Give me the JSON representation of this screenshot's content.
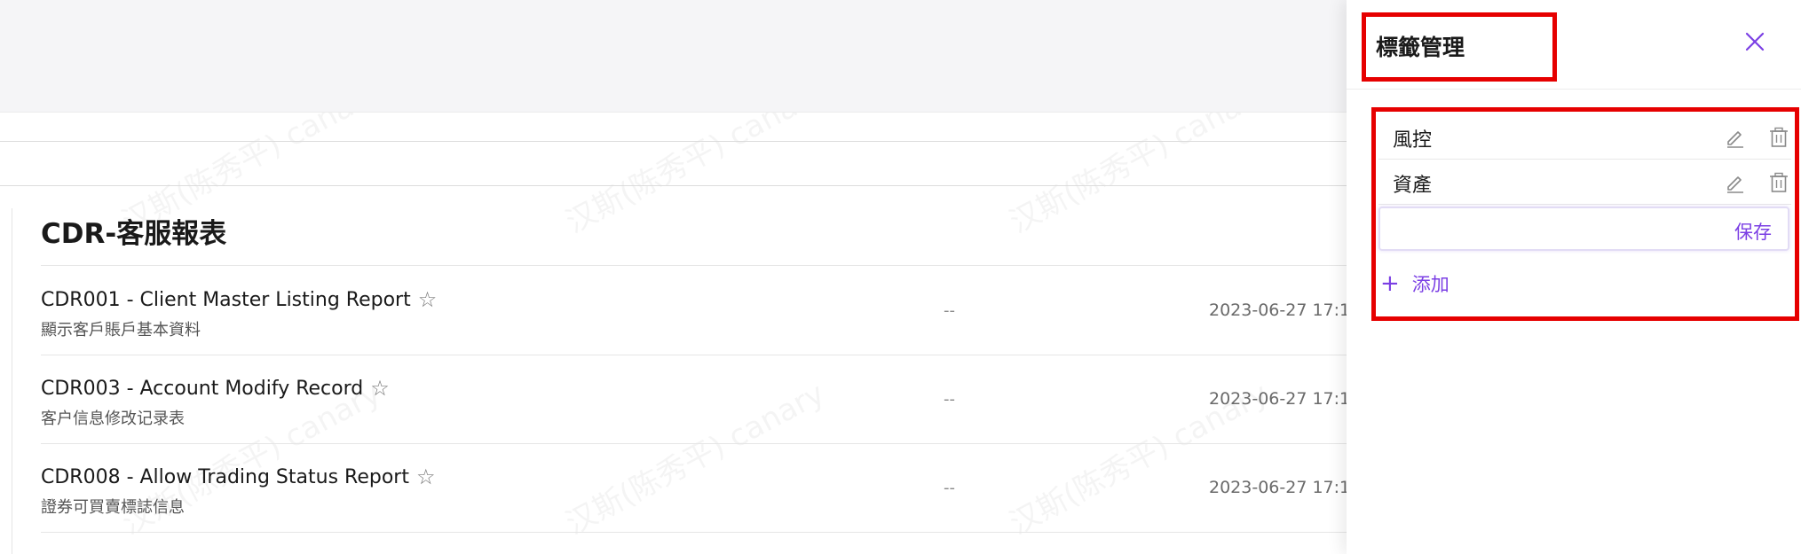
{
  "watermark": "汉斯(陈秀平) canary",
  "section": {
    "title": "CDR-客服報表"
  },
  "reports": [
    {
      "title": "CDR001 - Client Master Listing Report",
      "subtitle": "顯示客戶賬戶基本資料",
      "tag": "--",
      "date": "2023-06-27 17:1",
      "starred": false
    },
    {
      "title": "CDR003 - Account Modify Record",
      "subtitle": "客户信息修改记录表",
      "tag": "--",
      "date": "2023-06-27 17:1",
      "starred": false
    },
    {
      "title": "CDR008 - Allow Trading Status Report",
      "subtitle": "證券可買賣標誌信息",
      "tag": "--",
      "date": "2023-06-27 17:1",
      "starred": false
    }
  ],
  "drawer": {
    "title": "標籤管理",
    "tags": [
      {
        "label": "風控"
      },
      {
        "label": "資產"
      }
    ],
    "new_tag": {
      "value": "",
      "placeholder": ""
    },
    "save_label": "保存",
    "add_label": "添加"
  },
  "colors": {
    "accent": "#7b3fe4",
    "highlight": "#e60000",
    "icon": "#8a8a8a"
  },
  "icons": {
    "close": "close-icon",
    "edit": "pencil-icon",
    "delete": "trash-icon",
    "add": "plus-icon",
    "star": "star-outline-icon"
  }
}
